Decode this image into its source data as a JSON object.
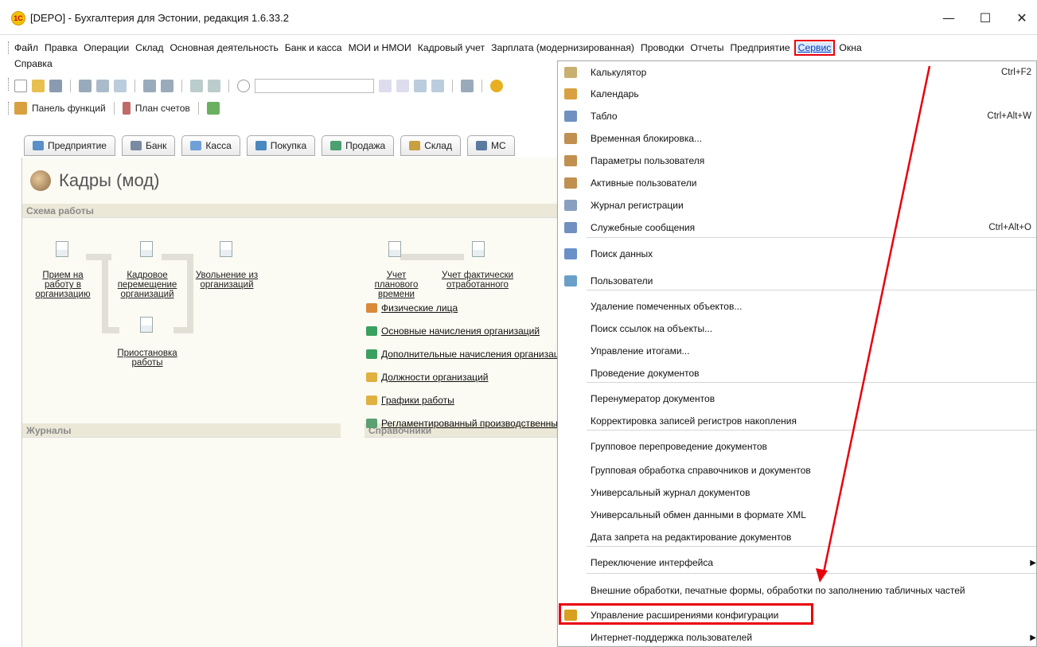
{
  "window": {
    "logo_text": "1С",
    "title": "[DEPO] - Бухгалтерия для Эстонии, редакция 1.6.33.2",
    "minimize": "—",
    "maximize": "☐",
    "close": "✕"
  },
  "menubar": {
    "items": [
      "Файл",
      "Правка",
      "Операции",
      "Склад",
      "Основная деятельность",
      "Банк и касса",
      "МОИ и НМОИ",
      "Кадровый учет",
      "Зарплата (модернизированная)",
      "Проводки",
      "Отчеты",
      "Предприятие",
      "Сервис",
      "Окна"
    ],
    "row2": "Справка",
    "active": "Сервис"
  },
  "toolbar2": {
    "functions_panel": "Панель функций",
    "chart_of_accounts": "План счетов"
  },
  "tabs": [
    {
      "label": "Предприятие",
      "color": "#5b8fc7"
    },
    {
      "label": "Банк",
      "color": "#7a8aa0"
    },
    {
      "label": "Касса",
      "color": "#6fa0d8"
    },
    {
      "label": "Покупка",
      "color": "#4a88c0"
    },
    {
      "label": "Продажа",
      "color": "#4aa070"
    },
    {
      "label": "Склад",
      "color": "#c8a040"
    },
    {
      "label": "МС",
      "color": "#5a7aa0"
    }
  ],
  "workspace": {
    "title": "Кадры (мод)",
    "schema_header": "Схема работы",
    "flow": {
      "hire": "Прием на работу в организацию",
      "transfer": "Кадровое перемещение организаций",
      "dismissal": "Увольнение из организаций",
      "suspension": "Приостановка работы",
      "planned_time": "Учет планового времени",
      "actual_time": "Учет фактически отработанного"
    },
    "journals_header": "Журналы",
    "references_header": "Справочники",
    "references": [
      {
        "label": "Физические лица",
        "color": "#d88a3a"
      },
      {
        "label": "Основные начисления организаций",
        "color": "#3aa060"
      },
      {
        "label": "Дополнительные начисления организаций",
        "color": "#3aa060"
      },
      {
        "label": "Должности организаций",
        "color": "#e0b040"
      },
      {
        "label": "Графики работы",
        "color": "#e0b040"
      },
      {
        "label": "Регламентированный производственный календарь",
        "color": "#5aa070"
      }
    ]
  },
  "service_menu": {
    "items": [
      {
        "label": "Калькулятор",
        "shortcut": "Ctrl+F2",
        "icon": "calculator-icon",
        "color": "#c8b070"
      },
      {
        "label": "Календарь",
        "shortcut": "",
        "icon": "calendar-icon",
        "color": "#d8a040"
      },
      {
        "label": "Табло",
        "shortcut": "Ctrl+Alt+W",
        "icon": "scoreboard-icon",
        "color": "#7090c0"
      },
      {
        "label": "Временная блокировка...",
        "shortcut": "",
        "icon": "lock-icon",
        "color": "#c09050"
      },
      {
        "label": "Параметры пользователя",
        "shortcut": "",
        "icon": "user-settings-icon",
        "color": "#c09050"
      },
      {
        "label": "Активные пользователи",
        "shortcut": "",
        "icon": "active-users-icon",
        "color": "#c09050"
      },
      {
        "label": "Журнал регистрации",
        "shortcut": "",
        "icon": "log-icon",
        "color": "#8aa0c0"
      },
      {
        "label": "Служебные сообщения",
        "shortcut": "Ctrl+Alt+O",
        "icon": "messages-icon",
        "color": "#7090c0"
      },
      {
        "label": "Поиск данных",
        "shortcut": "",
        "icon": "search-data-icon",
        "color": "#6a90c8"
      },
      {
        "label": "Пользователи",
        "shortcut": "",
        "icon": "users-icon",
        "color": "#6aa0c8"
      },
      {
        "label": "Удаление помеченных объектов...",
        "shortcut": "",
        "icon": "",
        "color": ""
      },
      {
        "label": "Поиск ссылок на объекты...",
        "shortcut": "",
        "icon": "",
        "color": ""
      },
      {
        "label": "Управление итогами...",
        "shortcut": "",
        "icon": "",
        "color": ""
      },
      {
        "label": "Проведение документов",
        "shortcut": "",
        "icon": "",
        "color": ""
      },
      {
        "label": "Перенумератор документов",
        "shortcut": "",
        "icon": "",
        "color": ""
      },
      {
        "label": "Корректировка записей регистров накопления",
        "shortcut": "",
        "icon": "",
        "color": ""
      },
      {
        "label": "Групповое перепроведение документов",
        "shortcut": "",
        "icon": "",
        "color": ""
      },
      {
        "label": "Групповая обработка справочников и документов",
        "shortcut": "",
        "icon": "",
        "color": ""
      },
      {
        "label": "Универсальный журнал документов",
        "shortcut": "",
        "icon": "",
        "color": ""
      },
      {
        "label": "Универсальный обмен данными в формате XML",
        "shortcut": "",
        "icon": "",
        "color": ""
      },
      {
        "label": "Дата запрета на редактирование документов",
        "shortcut": "",
        "icon": "",
        "color": ""
      },
      {
        "label": "Переключение интерфейса",
        "shortcut": "",
        "icon": "",
        "color": "",
        "submenu": true
      },
      {
        "label": "Внешние  обработки, печатные формы, обработки по заполнению табличных частей",
        "shortcut": "",
        "icon": "",
        "color": ""
      },
      {
        "label": "Управление расширениями конфигурации",
        "shortcut": "",
        "icon": "extensions-icon",
        "color": "#d8a020",
        "highlighted": true
      },
      {
        "label": "Интернет-поддержка пользователей",
        "shortcut": "",
        "icon": "",
        "color": "",
        "submenu": true
      }
    ],
    "submenu_arrow": "▶"
  },
  "annotation": {
    "color": "#e8000b"
  }
}
